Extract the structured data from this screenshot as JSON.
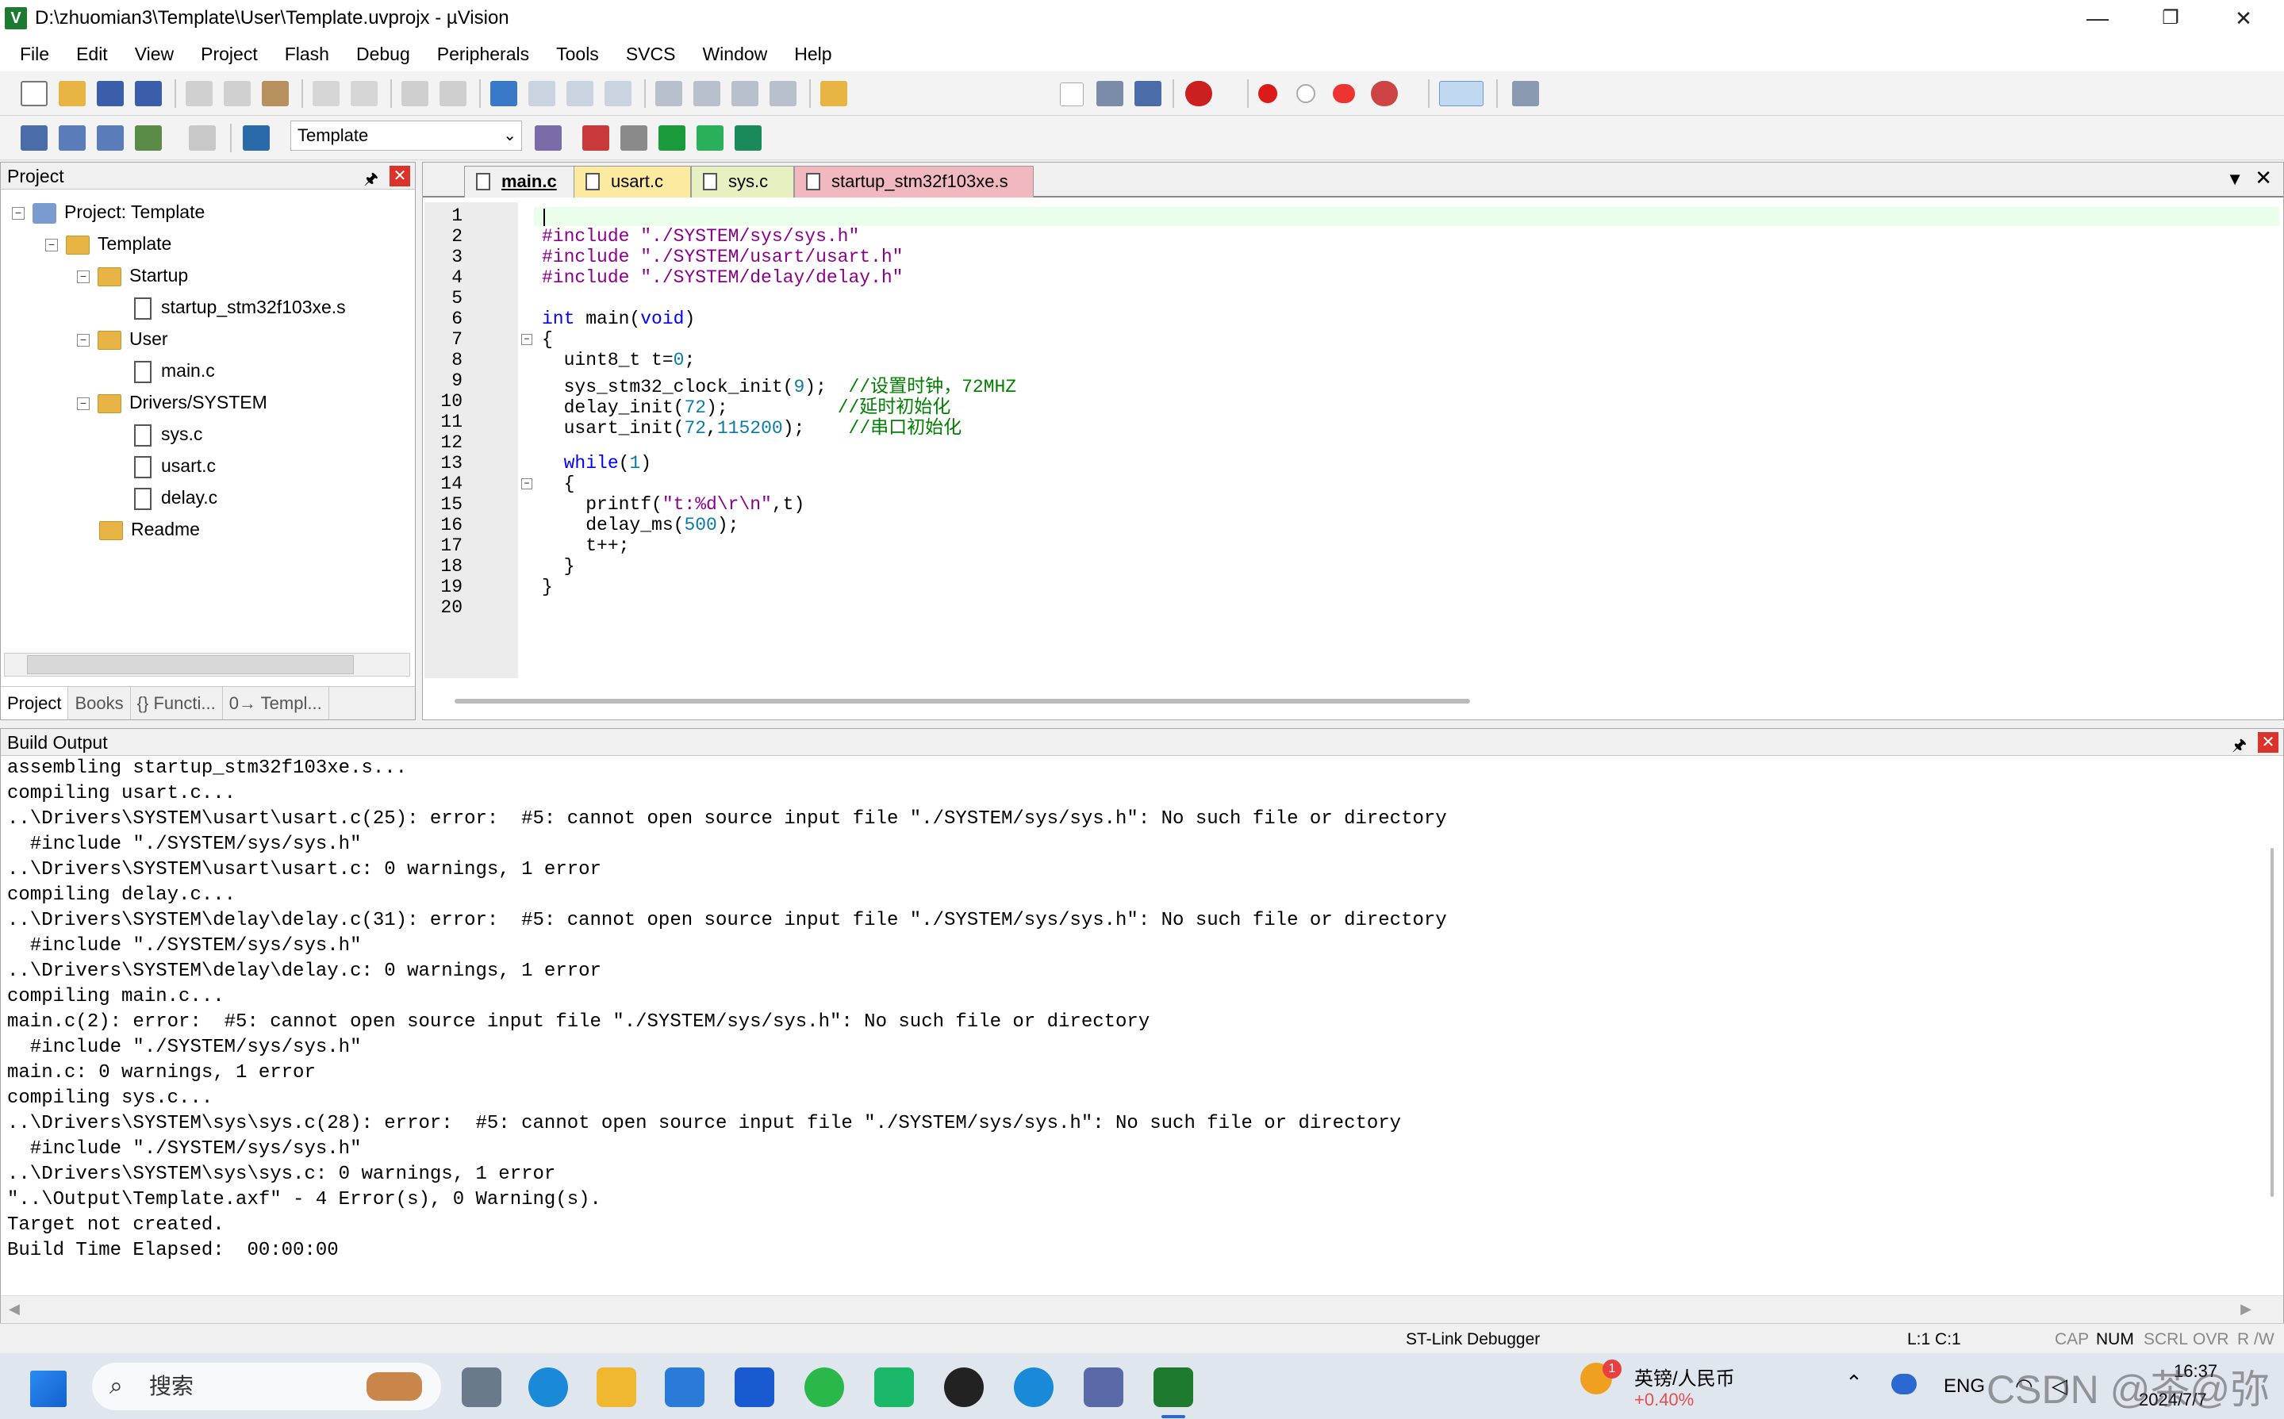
{
  "window": {
    "title": "D:\\zhuomian3\\Template\\User\\Template.uvprojx - µVision",
    "minimize": "—",
    "maximize": "❐",
    "close": "✕"
  },
  "menu": [
    "File",
    "Edit",
    "View",
    "Project",
    "Flash",
    "Debug",
    "Peripherals",
    "Tools",
    "SVCS",
    "Window",
    "Help"
  ],
  "toolbar2": {
    "target": "Template",
    "target_arrow": "⌄"
  },
  "project_pane": {
    "title": "Project",
    "pin": "🖈",
    "close": "✕",
    "tree": [
      {
        "label": "Project: Template",
        "kind": "root",
        "exp": "−"
      },
      {
        "label": "Template",
        "kind": "folder",
        "exp": "−"
      },
      {
        "label": "Startup",
        "kind": "folder",
        "exp": "−"
      },
      {
        "label": "startup_stm32f103xe.s",
        "kind": "file"
      },
      {
        "label": "User",
        "kind": "folder",
        "exp": "−"
      },
      {
        "label": "main.c",
        "kind": "file"
      },
      {
        "label": "Drivers/SYSTEM",
        "kind": "folder",
        "exp": "−"
      },
      {
        "label": "sys.c",
        "kind": "file"
      },
      {
        "label": "usart.c",
        "kind": "file"
      },
      {
        "label": "delay.c",
        "kind": "file"
      },
      {
        "label": "Readme",
        "kind": "folder"
      }
    ],
    "tabs": [
      "Project",
      "Books",
      "{} Functi...",
      "0→ Templ..."
    ]
  },
  "editor": {
    "tabs": [
      {
        "label": "main.c",
        "color": "#f0f0f0"
      },
      {
        "label": "usart.c",
        "color": "#fbeaa0"
      },
      {
        "label": "sys.c",
        "color": "#e6f0c0"
      },
      {
        "label": "startup_stm32f103xe.s",
        "color": "#f2b8c0"
      }
    ],
    "line_numbers": [
      "1",
      "2",
      "3",
      "4",
      "5",
      "6",
      "7",
      "8",
      "9",
      "10",
      "11",
      "12",
      "13",
      "14",
      "15",
      "16",
      "17",
      "18",
      "19",
      "20"
    ],
    "lines": [
      {
        "parts": [
          {
            "t": "",
            "c": ""
          }
        ]
      },
      {
        "parts": [
          {
            "t": "#include ",
            "c": "pp"
          },
          {
            "t": "\"./SYSTEM/sys/sys.h\"",
            "c": "str"
          }
        ]
      },
      {
        "parts": [
          {
            "t": "#include ",
            "c": "pp"
          },
          {
            "t": "\"./SYSTEM/usart/usart.h\"",
            "c": "str"
          }
        ]
      },
      {
        "parts": [
          {
            "t": "#include ",
            "c": "pp"
          },
          {
            "t": "\"./SYSTEM/delay/delay.h\"",
            "c": "str"
          }
        ]
      },
      {
        "parts": [
          {
            "t": "",
            "c": ""
          }
        ]
      },
      {
        "parts": [
          {
            "t": "int",
            "c": "kw"
          },
          {
            "t": " main(",
            "c": ""
          },
          {
            "t": "void",
            "c": "kw"
          },
          {
            "t": ")",
            "c": ""
          }
        ]
      },
      {
        "parts": [
          {
            "t": "{",
            "c": ""
          }
        ]
      },
      {
        "parts": [
          {
            "t": "  uint8_t t=",
            "c": ""
          },
          {
            "t": "0",
            "c": "num"
          },
          {
            "t": ";",
            "c": ""
          }
        ]
      },
      {
        "parts": [
          {
            "t": "  sys_stm32_clock_init(",
            "c": ""
          },
          {
            "t": "9",
            "c": "num"
          },
          {
            "t": ");  ",
            "c": ""
          },
          {
            "t": "//设置时钟，72MHZ",
            "c": "cm"
          }
        ]
      },
      {
        "parts": [
          {
            "t": "  delay_init(",
            "c": ""
          },
          {
            "t": "72",
            "c": "num"
          },
          {
            "t": ");          ",
            "c": ""
          },
          {
            "t": "//延时初始化",
            "c": "cm"
          }
        ]
      },
      {
        "parts": [
          {
            "t": "  usart_init(",
            "c": ""
          },
          {
            "t": "72",
            "c": "num"
          },
          {
            "t": ",",
            "c": ""
          },
          {
            "t": "115200",
            "c": "num"
          },
          {
            "t": ");    ",
            "c": ""
          },
          {
            "t": "//串口初始化",
            "c": "cm"
          }
        ]
      },
      {
        "parts": [
          {
            "t": "",
            "c": ""
          }
        ]
      },
      {
        "parts": [
          {
            "t": "  ",
            "c": ""
          },
          {
            "t": "while",
            "c": "kw"
          },
          {
            "t": "(",
            "c": ""
          },
          {
            "t": "1",
            "c": "num"
          },
          {
            "t": ")",
            "c": ""
          }
        ]
      },
      {
        "parts": [
          {
            "t": "  {",
            "c": ""
          }
        ]
      },
      {
        "parts": [
          {
            "t": "    printf(",
            "c": ""
          },
          {
            "t": "\"t:%d\\r\\n\"",
            "c": "str"
          },
          {
            "t": ",t)",
            "c": ""
          }
        ]
      },
      {
        "parts": [
          {
            "t": "    delay_ms(",
            "c": ""
          },
          {
            "t": "500",
            "c": "num"
          },
          {
            "t": ");",
            "c": ""
          }
        ]
      },
      {
        "parts": [
          {
            "t": "    t++;",
            "c": ""
          }
        ]
      },
      {
        "parts": [
          {
            "t": "  }",
            "c": ""
          }
        ]
      },
      {
        "parts": [
          {
            "t": "}",
            "c": ""
          }
        ]
      },
      {
        "parts": [
          {
            "t": "",
            "c": ""
          }
        ]
      }
    ]
  },
  "build_output": {
    "title": "Build Output",
    "pin": "🖈",
    "close": "✕",
    "lines": [
      "assembling startup_stm32f103xe.s...",
      "compiling usart.c...",
      "..\\Drivers\\SYSTEM\\usart\\usart.c(25): error:  #5: cannot open source input file \"./SYSTEM/sys/sys.h\": No such file or directory",
      "  #include \"./SYSTEM/sys/sys.h\"",
      "..\\Drivers\\SYSTEM\\usart\\usart.c: 0 warnings, 1 error",
      "compiling delay.c...",
      "..\\Drivers\\SYSTEM\\delay\\delay.c(31): error:  #5: cannot open source input file \"./SYSTEM/sys/sys.h\": No such file or directory",
      "  #include \"./SYSTEM/sys/sys.h\"",
      "..\\Drivers\\SYSTEM\\delay\\delay.c: 0 warnings, 1 error",
      "compiling main.c...",
      "main.c(2): error:  #5: cannot open source input file \"./SYSTEM/sys/sys.h\": No such file or directory",
      "  #include \"./SYSTEM/sys/sys.h\"",
      "main.c: 0 warnings, 1 error",
      "compiling sys.c...",
      "..\\Drivers\\SYSTEM\\sys\\sys.c(28): error:  #5: cannot open source input file \"./SYSTEM/sys/sys.h\": No such file or directory",
      "  #include \"./SYSTEM/sys/sys.h\"",
      "..\\Drivers\\SYSTEM\\sys\\sys.c: 0 warnings, 1 error",
      "\"..\\Output\\Template.axf\" - 4 Error(s), 0 Warning(s).",
      "Target not created.",
      "Build Time Elapsed:  00:00:00"
    ]
  },
  "status": {
    "debugger": "ST-Link Debugger",
    "cursor": "L:1 C:1",
    "cap": "CAP",
    "num": "NUM",
    "scrl": "SCRL",
    "ovr": "OVR",
    "rw": "R /W"
  },
  "taskbar": {
    "search": "搜索",
    "notify_badge": "1",
    "stock_name": "英镑/人民币",
    "stock_change": "+0.40%",
    "lang": "ENG",
    "time": "16:37",
    "date": "2024/7/7",
    "watermark": "CSDN @茶@弥"
  }
}
